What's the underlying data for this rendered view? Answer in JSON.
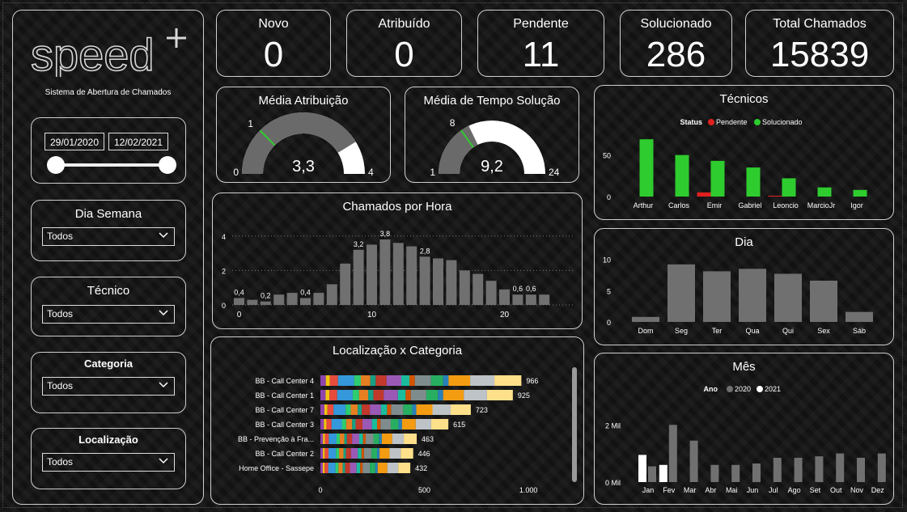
{
  "brand": {
    "logo_text": "speed",
    "subtitle": "Sistema de Abertura de Chamados"
  },
  "filters": {
    "date_from": "29/01/2020",
    "date_to": "12/02/2021",
    "dia_semana": {
      "label": "Dia Semana",
      "value": "Todos"
    },
    "tecnico": {
      "label": "Técnico",
      "value": "Todos"
    },
    "categoria": {
      "label": "Categoria",
      "value": "Todos"
    },
    "localizacao": {
      "label": "Localização",
      "value": "Todos"
    }
  },
  "kpis": [
    {
      "label": "Novo",
      "value": "0"
    },
    {
      "label": "Atribuído",
      "value": "0"
    },
    {
      "label": "Pendente",
      "value": "11"
    },
    {
      "label": "Solucionado",
      "value": "286"
    },
    {
      "label": "Total Chamados",
      "value": "15839"
    }
  ],
  "gauges": [
    {
      "title": "Média Atribuição",
      "min": "0",
      "max": "4",
      "value": "3,3",
      "target": "1",
      "value_num": 3.3,
      "target_num": 1,
      "min_num": 0,
      "max_num": 4
    },
    {
      "title": "Média de Tempo Solução",
      "min": "1",
      "max": "24",
      "value": "9,2",
      "target": "8",
      "value_num": 9.2,
      "target_num": 8,
      "min_num": 1,
      "max_num": 24
    }
  ],
  "colors": {
    "bar_gray": "#707070",
    "green": "#2ecc2e",
    "red": "#e02020",
    "white": "#ffffff",
    "gauge_bg": "#6a6a6a"
  },
  "chart_data": [
    {
      "type": "bar",
      "id": "tecnicos",
      "title": "Técnicos",
      "legend_title": "Status",
      "legend_position": "top-center",
      "categories": [
        "Arthur",
        "Carlos",
        "Emir",
        "Gabriel",
        "Leoncio",
        "MarcioJr",
        "Igor"
      ],
      "series": [
        {
          "name": "Pendente",
          "color": "#e02020",
          "values": [
            0,
            0,
            5,
            0,
            1,
            0,
            0
          ]
        },
        {
          "name": "Solucionado",
          "color": "#2ecc2e",
          "values": [
            69,
            50,
            43,
            35,
            22,
            11,
            8
          ]
        }
      ],
      "y_ticks": [
        "0",
        "50"
      ],
      "ylim": [
        0,
        75
      ]
    },
    {
      "type": "bar",
      "id": "por_hora",
      "title": "Chamados por Hora",
      "x": [
        0,
        1,
        2,
        3,
        4,
        5,
        6,
        7,
        8,
        9,
        10,
        11,
        12,
        13,
        14,
        15,
        16,
        17,
        18,
        19,
        20,
        21,
        22,
        23
      ],
      "values": [
        0.4,
        0.3,
        0.2,
        0.6,
        0.7,
        0.4,
        0.7,
        1.2,
        2.4,
        3.2,
        3.5,
        3.8,
        3.6,
        3.4,
        2.8,
        2.7,
        2.6,
        2.0,
        1.8,
        1.4,
        0.9,
        0.6,
        0.6,
        0.6
      ],
      "data_labels": {
        "0": "0,4",
        "2": "0,2",
        "5": "0,4",
        "9": "3,2",
        "11": "3,8",
        "14": "2,8",
        "21": "0,6",
        "22": "0,6"
      },
      "x_ticks": [
        "0",
        "10",
        "20"
      ],
      "y_ticks": [
        "0",
        "2",
        "4"
      ],
      "ylim": [
        0,
        4.6
      ]
    },
    {
      "type": "bar",
      "id": "dia",
      "title": "Dia",
      "categories": [
        "Dom",
        "Seg",
        "Ter",
        "Qua",
        "Qui",
        "Sex",
        "Sáb"
      ],
      "values": [
        0.8,
        9.2,
        8.1,
        8.5,
        7.7,
        6.6,
        1.6
      ],
      "y_ticks": [
        "0",
        "5",
        "10"
      ],
      "ylim": [
        0,
        11
      ]
    },
    {
      "type": "bar",
      "id": "mes",
      "title": "Mês",
      "legend_title": "Ano",
      "legend_position": "top-center",
      "categories": [
        "Jan",
        "Fev",
        "Mar",
        "Abr",
        "Mai",
        "Jun",
        "Jul",
        "Ago",
        "Set",
        "Out",
        "Nov",
        "Dez"
      ],
      "series": [
        {
          "name": "2020",
          "color": "#707070",
          "values": [
            550,
            2000,
            1450,
            600,
            600,
            650,
            850,
            850,
            900,
            1000,
            850,
            1000
          ]
        },
        {
          "name": "2021",
          "color": "#ffffff",
          "values": [
            950,
            600,
            0,
            0,
            0,
            0,
            0,
            0,
            0,
            0,
            0,
            0
          ]
        }
      ],
      "y_ticks": [
        "0 Mil",
        "2 Mil"
      ],
      "ylim": [
        0,
        2800
      ]
    },
    {
      "type": "bar",
      "orientation": "horizontal",
      "stacked": true,
      "id": "localizacao_categoria",
      "title": "Localização x Categoria",
      "categories": [
        "BB - Call Center 4",
        "BB - Call Center 1",
        "BB - Call Center 7",
        "BB - Call Center 3",
        "BB - Prevenção à Fra...",
        "BB - Call Center 2",
        "Home Office - Sassepe"
      ],
      "totals": [
        966,
        925,
        723,
        615,
        463,
        446,
        432
      ],
      "x_ticks": [
        "0",
        "500",
        "1.000"
      ],
      "xlim": [
        0,
        1050
      ],
      "segment_colors": [
        "#8e44ad",
        "#f1c40f",
        "#e74c3c",
        "#3498db",
        "#2ecc71",
        "#e67e22",
        "#16a085",
        "#c0392b",
        "#9b59b6",
        "#1abc9c",
        "#d35400",
        "#7f8c8d",
        "#27ae60",
        "#2980b9",
        "#f39c12",
        "#bdc3c7",
        "#ffe08a"
      ]
    }
  ]
}
